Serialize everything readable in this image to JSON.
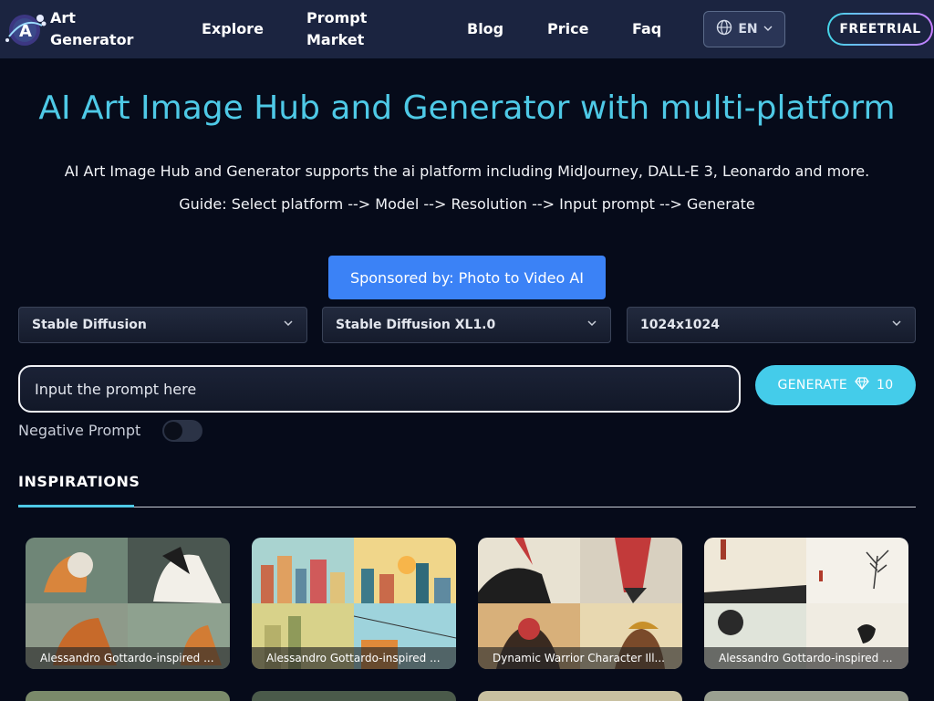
{
  "header": {
    "logo_line1": "Art",
    "logo_line2": "Generator",
    "nav": [
      {
        "label": "Explore"
      },
      {
        "label": "Prompt"
      },
      {
        "label": "Market"
      },
      {
        "label": "Blog"
      },
      {
        "label": "Price"
      },
      {
        "label": "Faq"
      }
    ],
    "language": "EN",
    "freetrial": "FREETRIAL"
  },
  "hero": {
    "title": "AI Art Image Hub and Generator with multi-platform",
    "subtitle": "AI Art Image Hub and Generator supports the ai platform including MidJourney, DALL-E 3, Leonardo and more.",
    "guide": "Guide: Select platform --> Model --> Resolution --> Input prompt --> Generate",
    "sponsor": "Sponsored by: Photo to Video AI"
  },
  "selects": {
    "platform": "Stable Diffusion",
    "model": "Stable Diffusion XL1.0",
    "resolution": "1024x1024"
  },
  "prompt": {
    "placeholder": "Input the prompt here",
    "generate_label": "GENERATE",
    "generate_cost": "10",
    "negative_label": "Negative Prompt"
  },
  "tabs": {
    "inspirations": "INSPIRATIONS"
  },
  "cards": [
    {
      "caption": "Alessandro Gottardo-inspired ..."
    },
    {
      "caption": "Alessandro Gottardo-inspired ..."
    },
    {
      "caption": "Dynamic Warrior Character Ill..."
    },
    {
      "caption": "Alessandro Gottardo-inspired ..."
    }
  ],
  "colors": {
    "accent": "#4ec9e6",
    "sponsor_bg": "#3b82f6",
    "generate_bg": "#44ccea",
    "header_bg": "#1b2440",
    "page_bg": "#060b1a"
  }
}
